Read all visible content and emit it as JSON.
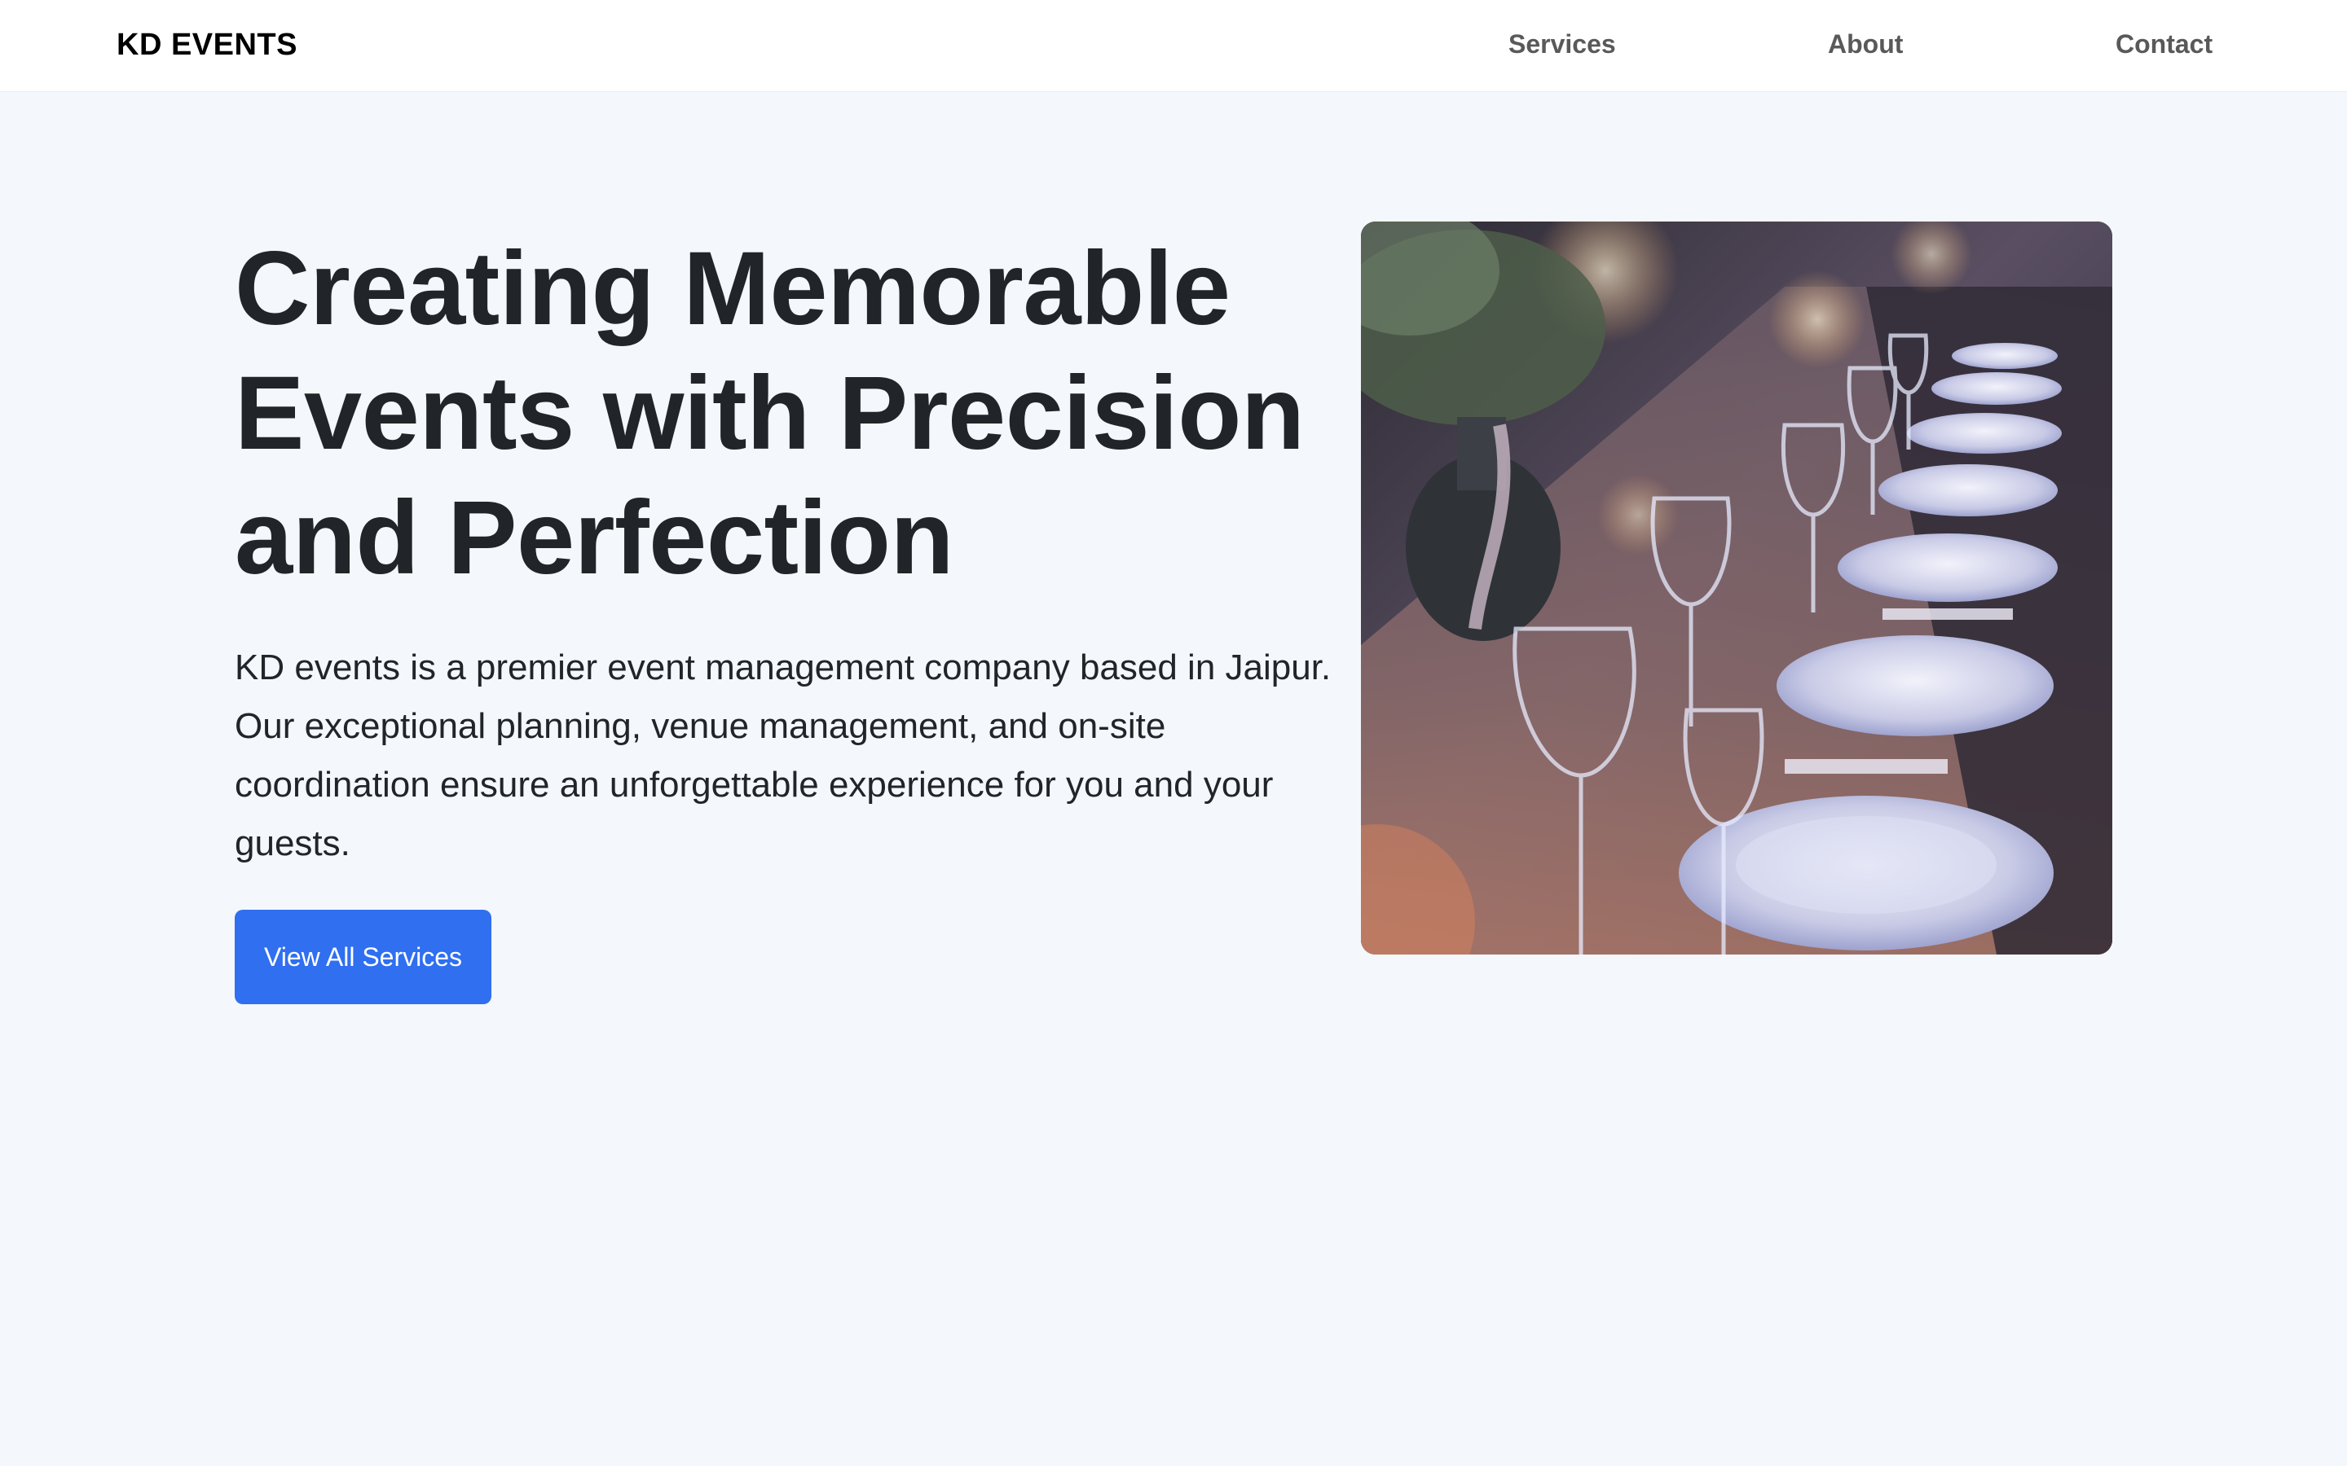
{
  "navbar": {
    "brand": "KD EVENTS",
    "links": [
      {
        "label": "Services"
      },
      {
        "label": "About"
      },
      {
        "label": "Contact"
      }
    ]
  },
  "hero": {
    "title": "Creating Memorable Events with Precision and Perfection",
    "description": "KD events is a premier event management company based in Jaipur. Our exceptional planning, venue management, and on-site coordination ensure an unforgettable experience for you and your guests.",
    "cta_label": "View All Services",
    "image_subject": "banquet-table-place-settings"
  },
  "colors": {
    "page_background": "#f4f7fb",
    "navbar_background": "#ffffff",
    "heading_text": "#212529",
    "nav_link": "#595959",
    "primary_button": "#2f6ff0"
  }
}
